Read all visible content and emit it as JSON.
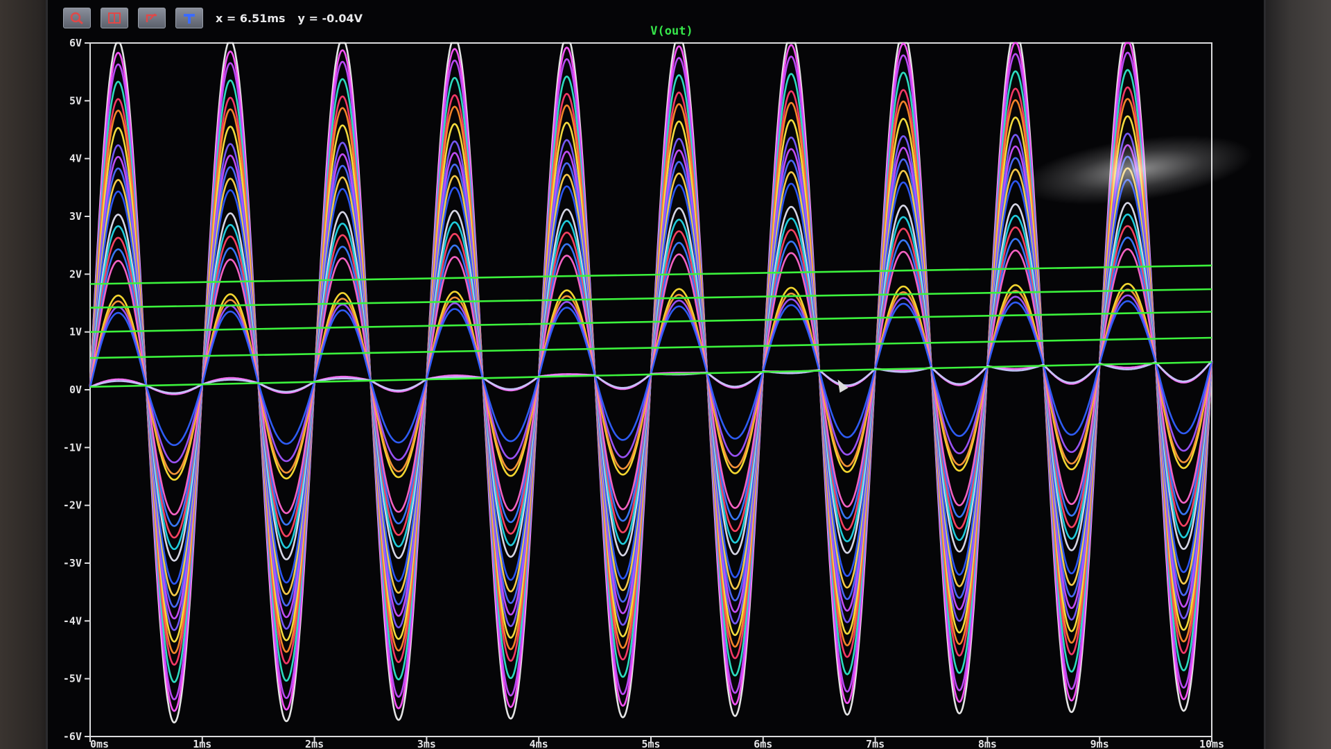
{
  "toolbar": {
    "buttons": [
      {
        "name": "zoom-icon",
        "label": ""
      },
      {
        "name": "autorange-icon",
        "label": ""
      },
      {
        "name": "pan-icon",
        "label": ""
      },
      {
        "name": "mark-icon",
        "label": ""
      }
    ],
    "cursor_x": "x = 6.51ms",
    "cursor_y": "y = -0.04V"
  },
  "colors": {
    "background": "#050507",
    "axis": "#dcdcde",
    "title": "#36e64a",
    "green_traces": "#3cf23c"
  },
  "chart_data": {
    "type": "line",
    "title": "V(out)",
    "xlabel": "",
    "ylabel": "",
    "xlim": [
      0,
      10
    ],
    "ylim": [
      -6,
      6
    ],
    "x_ticks": [
      "0ms",
      "1ms",
      "2ms",
      "3ms",
      "4ms",
      "5ms",
      "6ms",
      "7ms",
      "8ms",
      "9ms",
      "10ms"
    ],
    "y_ticks": [
      "-6V",
      "-5V",
      "-4V",
      "-3V",
      "-2V",
      "-1V",
      "0V",
      "1V",
      "2V",
      "3V",
      "4V",
      "5V",
      "6V"
    ],
    "grid": false,
    "frequency_hz": 1000,
    "sine_series": [
      {
        "color": "#f0f0f0",
        "peak": 6.0,
        "trough": -5.8
      },
      {
        "color": "#ff55ff",
        "peak": 5.8,
        "trough": -5.6
      },
      {
        "color": "#c24dff",
        "peak": 5.6,
        "trough": -5.4
      },
      {
        "color": "#2ee6c8",
        "peak": 5.3,
        "trough": -5.1
      },
      {
        "color": "#ff3b6b",
        "peak": 5.0,
        "trough": -4.8
      },
      {
        "color": "#ff8a2b",
        "peak": 4.8,
        "trough": -4.6
      },
      {
        "color": "#ffe640",
        "peak": 4.5,
        "trough": -4.4
      },
      {
        "color": "#7a5cff",
        "peak": 4.2,
        "trough": -4.2
      },
      {
        "color": "#c850ff",
        "peak": 4.0,
        "trough": -4.0
      },
      {
        "color": "#4d6bff",
        "peak": 3.8,
        "trough": -3.8
      },
      {
        "color": "#ffd34d",
        "peak": 3.6,
        "trough": -3.6
      },
      {
        "color": "#2f5bff",
        "peak": 3.4,
        "trough": -3.4
      },
      {
        "color": "#e0e0f0",
        "peak": 3.0,
        "trough": -3.0
      },
      {
        "color": "#22d6e6",
        "peak": 2.8,
        "trough": -2.8
      },
      {
        "color": "#ff4466",
        "peak": 2.6,
        "trough": -2.6
      },
      {
        "color": "#3a7bff",
        "peak": 2.4,
        "trough": -2.4
      },
      {
        "color": "#ff66cc",
        "peak": 2.2,
        "trough": -2.2
      },
      {
        "color": "#ffe033",
        "peak": 1.6,
        "trough": -1.6
      },
      {
        "color": "#ff9a3a",
        "peak": 1.5,
        "trough": -1.5
      },
      {
        "color": "#a055ff",
        "peak": 1.4,
        "trough": -1.3
      },
      {
        "color": "#3060ff",
        "peak": 1.3,
        "trough": -1.0
      },
      {
        "color": "#ff77ff",
        "peak": 0.15,
        "trough": -0.12
      },
      {
        "color": "#c8c8ff",
        "peak": 0.12,
        "trough": -0.1
      }
    ],
    "dc_series": [
      {
        "color": "#3cf23c",
        "y_start": 1.83,
        "y_end": 2.15
      },
      {
        "color": "#3cf23c",
        "y_start": 1.42,
        "y_end": 1.74
      },
      {
        "color": "#3cf23c",
        "y_start": 1.0,
        "y_end": 1.35
      },
      {
        "color": "#3cf23c",
        "y_start": 0.55,
        "y_end": 0.9
      },
      {
        "color": "#3cf23c",
        "y_start": 0.05,
        "y_end": 0.48
      }
    ],
    "rising_baseline": [
      0.05,
      0.5
    ]
  }
}
